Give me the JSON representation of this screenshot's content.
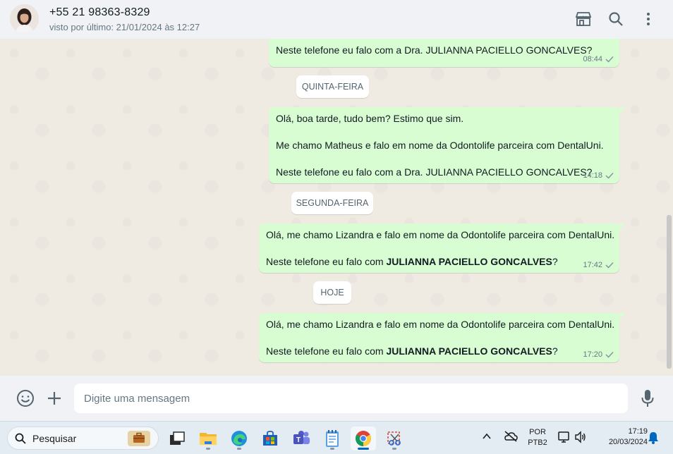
{
  "header": {
    "contact_name": "+55 21 98363-8329",
    "last_seen": "visto por último: 21/01/2024 às 12:27"
  },
  "messages": [
    {
      "lines": [
        "Neste telefone eu falo com a Dra. JULIANNA PACIELLO GONCALVES?"
      ],
      "time": "08:44"
    },
    {
      "day": "QUINTA-FEIRA"
    },
    {
      "lines": [
        "Olá, boa tarde, tudo bem? Estimo que sim.",
        "Me chamo Matheus e falo em nome da Odontolife parceira com DentalUni.",
        "Neste telefone eu falo com a Dra. JULIANNA PACIELLO GONCALVES?"
      ],
      "time": "14:18"
    },
    {
      "day": "SEGUNDA-FEIRA"
    },
    {
      "lines": [
        "Olá, me chamo Lizandra e falo em nome da Odontolife parceira com DentalUni."
      ],
      "bold_prefix": "Neste telefone eu falo com ",
      "bold": "JULIANNA PACIELLO GONCALVES",
      "bold_suffix": "?",
      "time": "17:42"
    },
    {
      "day": "HOJE"
    },
    {
      "lines": [
        "Olá, me chamo Lizandra e falo em nome da Odontolife parceira com DentalUni."
      ],
      "bold_prefix": "Neste telefone eu falo com ",
      "bold": "JULIANNA PACIELLO GONCALVES",
      "bold_suffix": "?",
      "time": "17:20"
    }
  ],
  "composer": {
    "placeholder": "Digite uma mensagem"
  },
  "taskbar": {
    "search_label": "Pesquisar",
    "language": "POR",
    "keyboard": "PTB2",
    "clock_time": "17:19",
    "clock_date": "20/03/2024"
  },
  "colors": {
    "outgoing_bubble": "#d9fdd3",
    "chat_bg": "#efeae2",
    "header_bg": "#f0f2f5"
  }
}
